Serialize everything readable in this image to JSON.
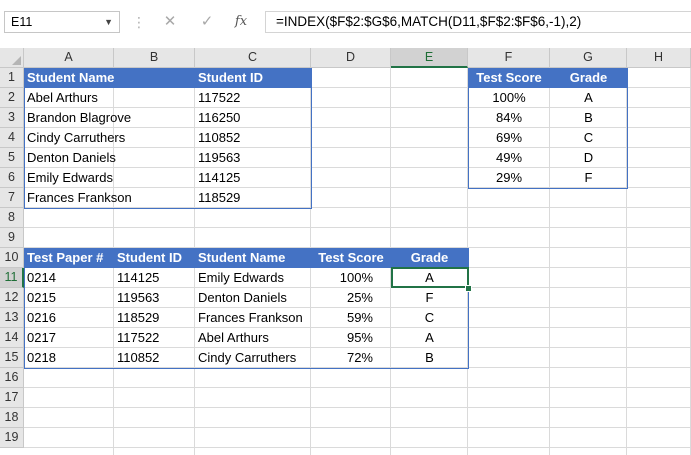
{
  "formula_bar": {
    "name_box": "E11",
    "formula": "=INDEX($F$2:$G$6,MATCH(D11,$F$2:$F$6,-1),2)",
    "cancel_glyph": "✕",
    "enter_glyph": "✓",
    "fx_glyph": "fx",
    "dropdown_glyph": "▼",
    "separator_glyph": "⋮"
  },
  "columns": [
    "A",
    "B",
    "C",
    "D",
    "E",
    "F",
    "G",
    "H"
  ],
  "rows": [
    "1",
    "2",
    "3",
    "4",
    "5",
    "6",
    "7",
    "8",
    "9",
    "10",
    "11",
    "12",
    "13",
    "14",
    "15",
    "16",
    "17",
    "18",
    "19"
  ],
  "active_cell": "E11",
  "students_table": {
    "headers": [
      "Student Name",
      "Student ID"
    ],
    "rows": [
      [
        "Abel Arthurs",
        "117522"
      ],
      [
        "Brandon Blagrove",
        "116250"
      ],
      [
        "Cindy Carruthers",
        "110852"
      ],
      [
        "Denton Daniels",
        "119563"
      ],
      [
        "Emily Edwards",
        "114125"
      ],
      [
        "Frances Frankson",
        "118529"
      ]
    ]
  },
  "grades_table": {
    "headers": [
      "Test Score",
      "Grade"
    ],
    "rows": [
      [
        "100%",
        "A"
      ],
      [
        "84%",
        "B"
      ],
      [
        "69%",
        "C"
      ],
      [
        "49%",
        "D"
      ],
      [
        "29%",
        "F"
      ]
    ]
  },
  "results_table": {
    "headers": [
      "Test Paper #",
      "Student ID",
      "Student Name",
      "Test Score",
      "Grade"
    ],
    "rows": [
      [
        "0214",
        "114125",
        "Emily Edwards",
        "100%",
        "A"
      ],
      [
        "0215",
        "119563",
        "Denton Daniels",
        "25%",
        "F"
      ],
      [
        "0216",
        "118529",
        "Frances Frankson",
        "59%",
        "C"
      ],
      [
        "0217",
        "117522",
        "Abel Arthurs",
        "95%",
        "A"
      ],
      [
        "0218",
        "110852",
        "Cindy Carruthers",
        "72%",
        "B"
      ]
    ]
  }
}
